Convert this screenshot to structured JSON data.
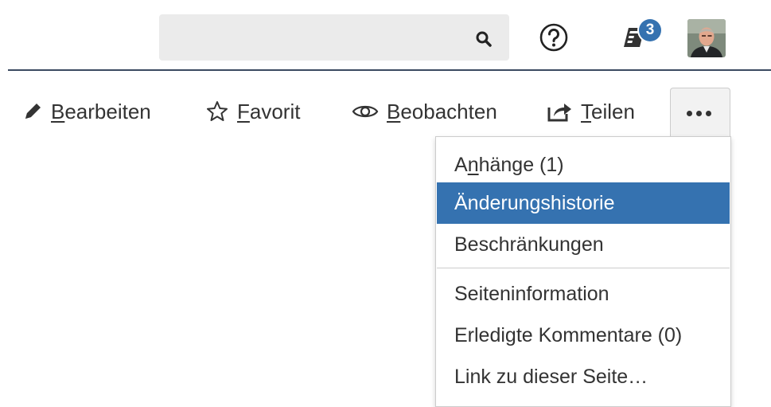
{
  "header": {
    "search": {
      "placeholder": "",
      "value": ""
    },
    "help_icon": "question-circle",
    "notifications": {
      "icon": "tasks-icon",
      "count": "3",
      "badge_color": "#3572b0"
    },
    "avatar": {
      "icon": "user-avatar"
    },
    "divider_color": "#3b4a61"
  },
  "toolbar": {
    "edit": {
      "icon": "pencil-icon",
      "accel": "B",
      "rest": "earbeiten"
    },
    "favorite": {
      "icon": "star-outline-icon",
      "accel": "F",
      "rest": "avorit"
    },
    "watch": {
      "icon": "eye-icon",
      "accel": "B",
      "rest": "eobachten"
    },
    "share": {
      "icon": "share-icon",
      "accel": "T",
      "rest": "eilen"
    },
    "more": {
      "icon": "ellipsis-icon"
    }
  },
  "dropdown": {
    "items": [
      {
        "pre": "A",
        "accel": "n",
        "rest": "hänge (1)"
      },
      {
        "label": "Änderungshistorie",
        "selected": true
      },
      {
        "label": "Beschränkungen"
      },
      {
        "label": "Seiteninformation"
      },
      {
        "label": "Erledigte Kommentare (0)"
      },
      {
        "label": "Link zu dieser Seite…"
      }
    ],
    "highlight_color": "#3572b0"
  }
}
